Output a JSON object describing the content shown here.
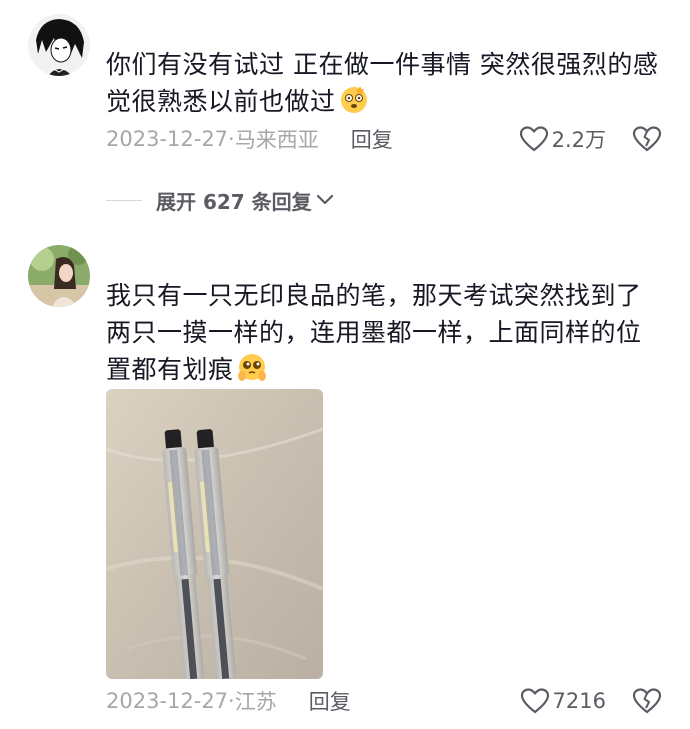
{
  "comments": [
    {
      "avatar_icon": "anime-avatar-icon",
      "text": "你们有没有试过 正在做一件事情 突然很强烈的感觉很熟悉以前也做过",
      "emoji": "dizzy-face-emoji",
      "date": "2023-12-27",
      "location": "马来西亚",
      "reply_label": "回复",
      "like_count": "2.2万",
      "expand_label": "展开 627 条回复"
    },
    {
      "avatar_icon": "photo-avatar-icon",
      "text": "我只有一只无印良品的笔，那天考试突然找到了两只一摸一样的，连用墨都一样，上面同样的位置都有划痕",
      "emoji": "pleading-face-emoji",
      "date": "2023-12-27",
      "location": "江苏",
      "reply_label": "回复",
      "like_count": "7216"
    }
  ],
  "colors": {
    "text": "#161823",
    "meta": "#a6a7ab",
    "action": "#5b5c63"
  }
}
